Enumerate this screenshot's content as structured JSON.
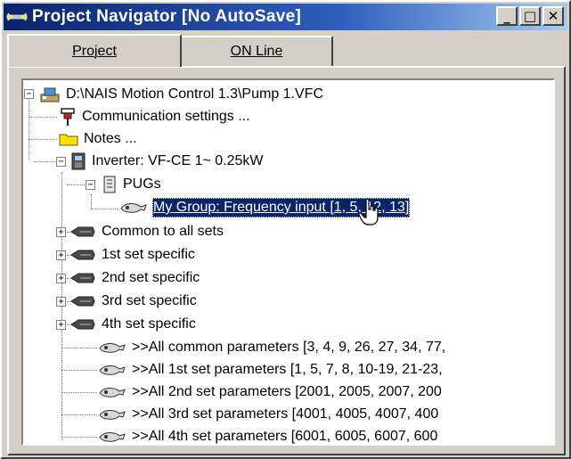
{
  "window": {
    "title": "Project Navigator [No AutoSave]",
    "controls": {
      "minimize": "_",
      "maximize": "□",
      "close": "✕"
    }
  },
  "tabs": [
    {
      "label": "Project",
      "active": true
    },
    {
      "label": "ON Line",
      "active": false
    }
  ],
  "tree": {
    "root": {
      "label": "D:\\NAIS Motion Control 1.3\\Pump 1.VFC",
      "icon": "project-icon",
      "expanded": true
    },
    "communication": {
      "label": "Communication settings ...",
      "icon": "plug-icon"
    },
    "notes": {
      "label": "Notes ...",
      "icon": "folder-icon"
    },
    "inverter": {
      "label": "Inverter: VF-CE 1~ 0.25kW",
      "icon": "inverter-icon",
      "expanded": true
    },
    "pugs": {
      "label": "PUGs",
      "icon": "pug-icon",
      "expanded": true
    },
    "selected_item": {
      "label": "My Group: Frequency input [1, 5, 12, 13]",
      "icon": "parameter-group-icon",
      "selected": true
    },
    "sets": [
      {
        "label": "Common to all sets",
        "icon": "set-icon"
      },
      {
        "label": "1st set specific",
        "icon": "set-icon"
      },
      {
        "label": "2nd set specific",
        "icon": "set-icon"
      },
      {
        "label": "3rd set specific",
        "icon": "set-icon"
      },
      {
        "label": "4th set specific",
        "icon": "set-icon"
      }
    ],
    "all_params": [
      {
        "label": ">>All common parameters [3, 4, 9, 26, 27, 34, 77,",
        "icon": "parameter-group-icon"
      },
      {
        "label": ">>All 1st set parameters [1, 5, 7, 8, 10-19, 21-23,",
        "icon": "parameter-group-icon"
      },
      {
        "label": ">>All 2nd set parameters [2001, 2005, 2007, 200",
        "icon": "parameter-group-icon"
      },
      {
        "label": ">>All 3rd set parameters [4001, 4005, 4007, 400",
        "icon": "parameter-group-icon"
      },
      {
        "label": ">>All 4th set parameters [6001, 6005, 6007, 600",
        "icon": "parameter-group-icon"
      }
    ]
  },
  "colors": {
    "title_gradient_start": "#0a246a",
    "title_gradient_end": "#a6caf0",
    "selection": "#0a246a",
    "face": "#d4d0c8"
  }
}
